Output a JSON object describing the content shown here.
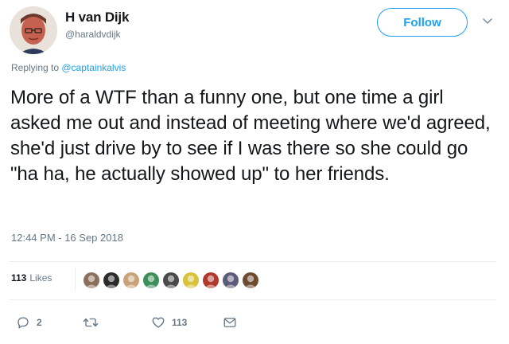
{
  "author": {
    "name": "H van Dijk",
    "handle": "@haraldvdijk"
  },
  "follow_button": {
    "label": "Follow"
  },
  "reply": {
    "prefix": "Replying to ",
    "mention": "@captainkalvis"
  },
  "tweet": {
    "text": "More of a WTF than a funny one, but one time a girl asked me out and instead of meeting where we'd agreed, she'd just drive by to see if I was there so she could go \"ha ha, he actually showed up\" to her friends.",
    "timestamp": "12:44 PM - 16 Sep 2018"
  },
  "likes": {
    "count": "113",
    "label": "Likes",
    "avatars": [
      {
        "icon": "liker-avatar",
        "color": "#8b6f5a"
      },
      {
        "icon": "liker-avatar",
        "color": "#2b2b2b"
      },
      {
        "icon": "liker-avatar",
        "color": "#c9a27a"
      },
      {
        "icon": "liker-avatar",
        "color": "#3c8f5a"
      },
      {
        "icon": "liker-avatar",
        "color": "#4a4a4a"
      },
      {
        "icon": "liker-avatar",
        "color": "#d8c23a"
      },
      {
        "icon": "liker-avatar",
        "color": "#b0392b"
      },
      {
        "icon": "liker-avatar",
        "color": "#5b5b7a"
      },
      {
        "icon": "liker-avatar",
        "color": "#6e4a2f"
      }
    ]
  },
  "actions": {
    "reply_count": "2",
    "retweet_count": "",
    "like_count": "113"
  },
  "colors": {
    "accent": "#1da1f2",
    "secondary_text": "#657786",
    "primary_text": "#14171a"
  }
}
